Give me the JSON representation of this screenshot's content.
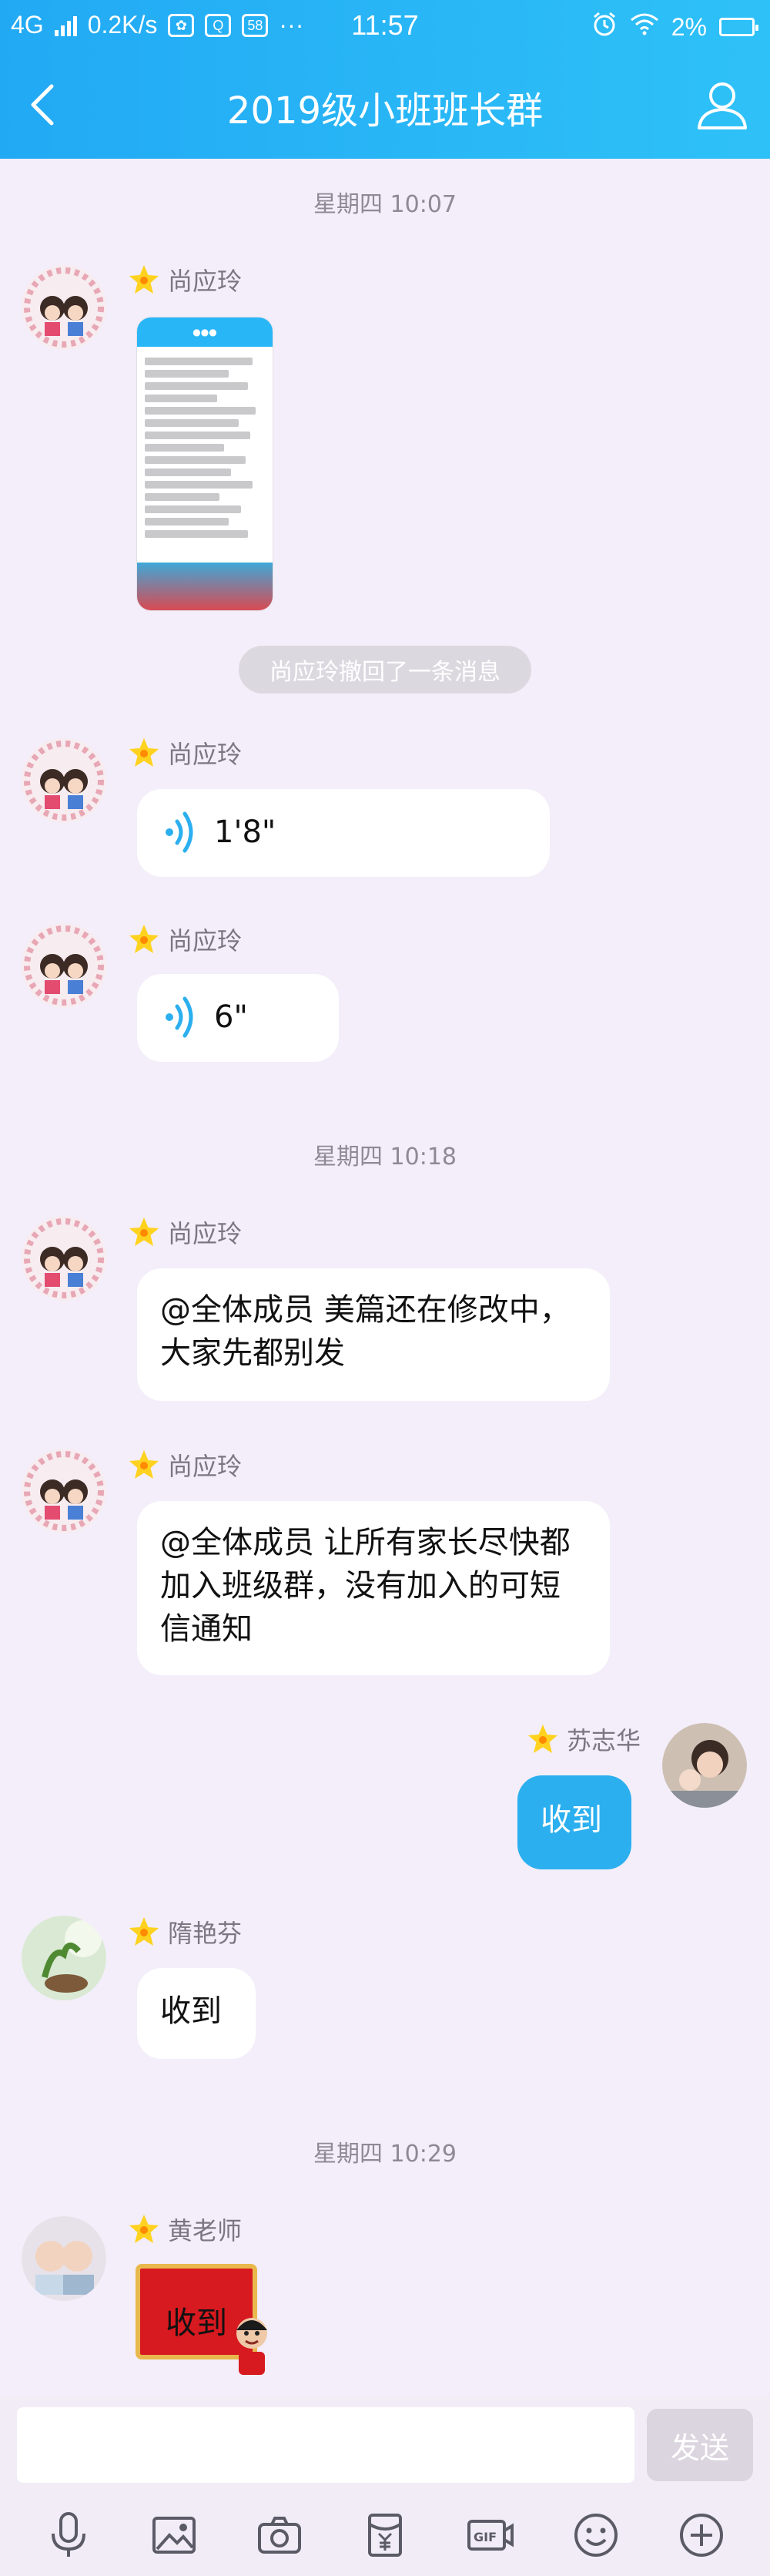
{
  "status_bar": {
    "network": "4G",
    "speed": "0.2K/s",
    "app_badge": "58",
    "more": "···",
    "time": "11:57",
    "battery": "2%"
  },
  "nav": {
    "title": "2019级小班班长群"
  },
  "messages": {
    "sep1": "星期四 10:07",
    "sep2": "星期四 10:18",
    "sep3": "星期四 10:29",
    "system_recall": "尚应玲撤回了一条消息",
    "m1_name": "尚应玲",
    "m2_name": "尚应玲",
    "m2_voice": "1'8\"",
    "m3_name": "尚应玲",
    "m3_voice": "6\"",
    "m4_name": "尚应玲",
    "m4_text": "@全体成员 美篇还在修改中，大家先都别发",
    "m5_name": "尚应玲",
    "m5_text": "@全体成员 让所有家长尽快都加入班级群，没有加入的可短信通知",
    "m6_name": "苏志华",
    "m6_text": "收到",
    "m7_name": "隋艳芬",
    "m7_text": "收到",
    "m8_name": "黄老师",
    "m8_sticker_text": "收到"
  },
  "input": {
    "placeholder": "",
    "send_label": "发送"
  },
  "toolbar_icons": [
    "microphone-icon",
    "image-icon",
    "camera-icon",
    "red-envelope-icon",
    "gif-icon",
    "emoji-icon",
    "plus-icon"
  ],
  "colors": {
    "header": "#2bb0f3",
    "background": "#f3eef9",
    "my_bubble": "#2bafef"
  }
}
